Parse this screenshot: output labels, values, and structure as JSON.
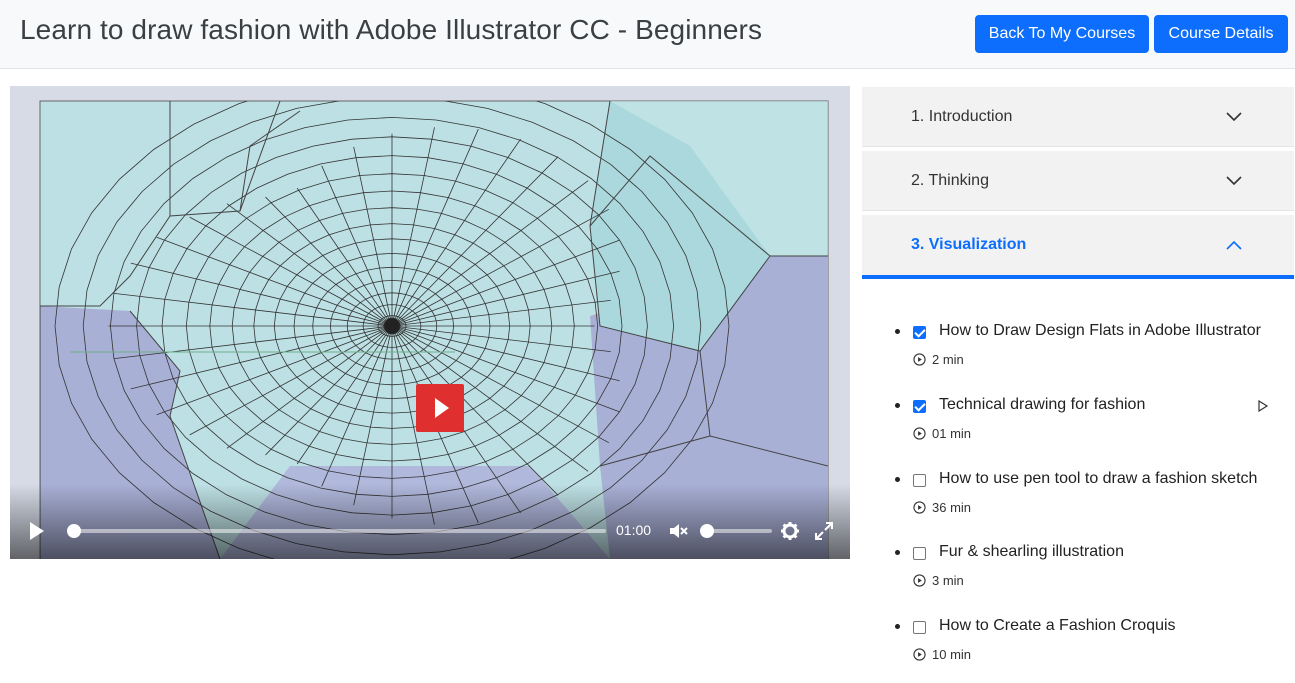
{
  "header": {
    "title": "Learn to draw fashion with Adobe Illustrator CC - Beginners",
    "back_button": "Back To My Courses",
    "details_button": "Course Details"
  },
  "player": {
    "current_time": "01:00",
    "progress": 0.01,
    "volume": 0.0,
    "muted": true,
    "icons": [
      "play-icon",
      "mute-icon",
      "gear-icon",
      "fullscreen-icon"
    ]
  },
  "sections": [
    {
      "label": "1. Introduction",
      "expanded": false
    },
    {
      "label": "2. Thinking",
      "expanded": false
    },
    {
      "label": "3. Visualization",
      "expanded": true
    }
  ],
  "lessons": [
    {
      "title": "How to Draw Design Flats in Adobe Illustrator",
      "duration": "2 min",
      "completed": true
    },
    {
      "title": "Technical drawing for fashion",
      "duration": "01 min",
      "completed": true,
      "current": true
    },
    {
      "title": "How to use pen tool to draw a fashion sketch",
      "duration": "36 min",
      "completed": false
    },
    {
      "title": "Fur & shearling illustration",
      "duration": "3 min",
      "completed": false
    },
    {
      "title": "How to Create a Fashion Croquis",
      "duration": "10 min",
      "completed": false
    }
  ],
  "colors": {
    "accent": "#0d6efd",
    "play_button": "#e02f2f"
  }
}
